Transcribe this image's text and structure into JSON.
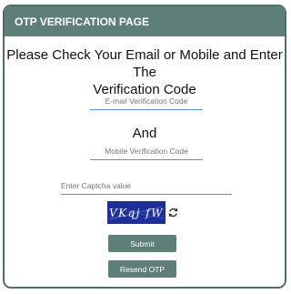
{
  "header": {
    "title": "OTP VERIFICATION PAGE"
  },
  "main": {
    "heading_line1": "Please Check Your Email or Mobile and Enter The",
    "heading_line2": "Verification Code",
    "email_code": {
      "placeholder": "E-mail Verification Code",
      "value": ""
    },
    "separator": "And",
    "mobile_code": {
      "placeholder": "Mobile Verification Code",
      "value": ""
    },
    "captcha_input": {
      "placeholder": "Enter Captcha value",
      "value": ""
    },
    "captcha_text": "VKqj fW",
    "submit_label": "Submit",
    "resend_label": "Resend OTP"
  },
  "colors": {
    "header_bg": "#5e7e7a",
    "button_bg": "#5e7e7a",
    "field_underline": "#5b8fd4",
    "captcha_bg": "#1d2f9a"
  },
  "icons": {
    "refresh": "refresh-icon"
  }
}
